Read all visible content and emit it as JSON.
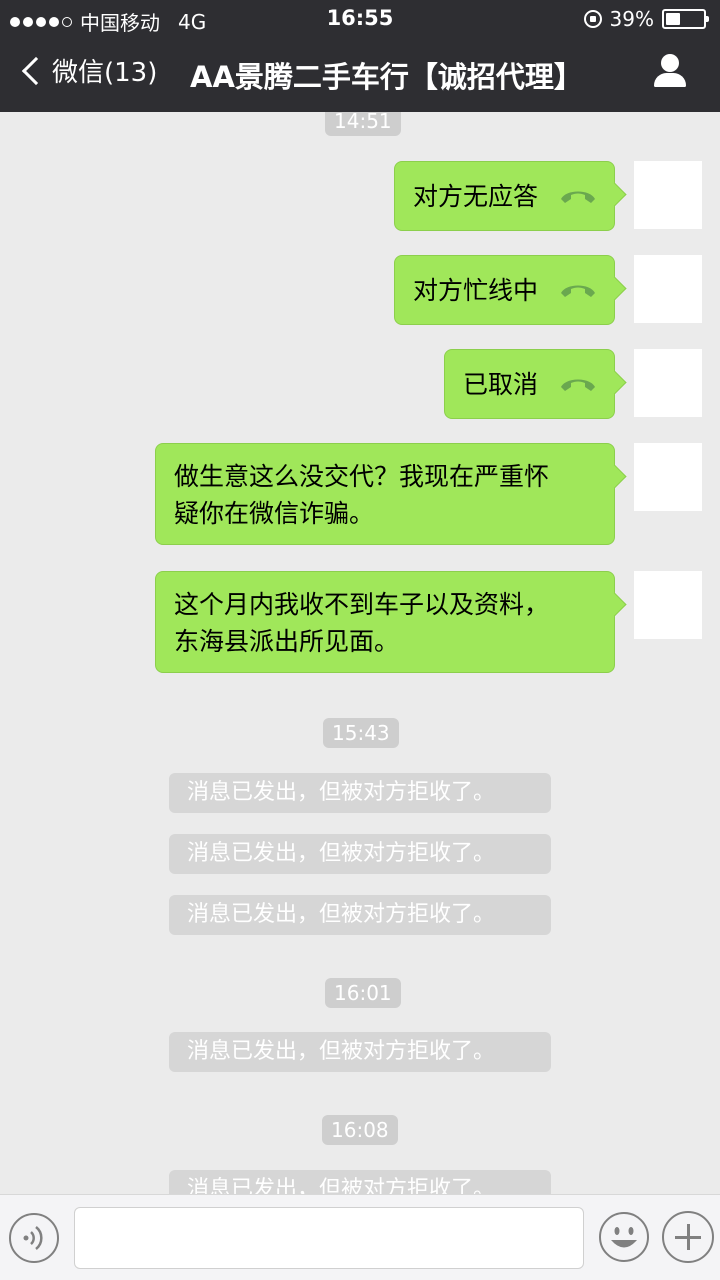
{
  "status_bar": {
    "carrier": "中国移动",
    "network": "4G",
    "time": "16:55",
    "battery": "39%",
    "battery_level": 0.39,
    "signal_bars": 4,
    "signal_max": 5
  },
  "nav": {
    "back_label": "微信(13)",
    "title": "AA景腾二手车行【诚招代理】"
  },
  "chat": {
    "timestamps": [
      "14:51",
      "15:43",
      "16:01",
      "16:08"
    ],
    "calls": [
      {
        "label": "对方无应答",
        "icon": "phone-hangup-icon"
      },
      {
        "label": "对方忙线中",
        "icon": "phone-hangup-icon"
      },
      {
        "label": "已取消",
        "icon": "phone-hangup-icon"
      }
    ],
    "messages": [
      {
        "line1": "做生意这么没交代？我现在严重怀",
        "line2": "疑你在微信诈骗。"
      },
      {
        "line1": "这个月内我收不到车子以及资料，",
        "line2": "东海县派出所见面。"
      }
    ],
    "system_notices": [
      "消息已发出，但被对方拒收了。",
      "消息已发出，但被对方拒收了。",
      "消息已发出，但被对方拒收了。",
      "消息已发出，但被对方拒收了。",
      "消息已发出，但被对方拒收了。"
    ]
  },
  "input_bar": {
    "voice_icon": "voice-icon",
    "emoji_icon": "emoji-icon",
    "plus_icon": "plus-icon"
  },
  "colors": {
    "header_bg": "#2e2e32",
    "chat_bg": "#ebebeb",
    "bubble_green": "#a0e75a",
    "phone_icon": "#6aa84f"
  }
}
